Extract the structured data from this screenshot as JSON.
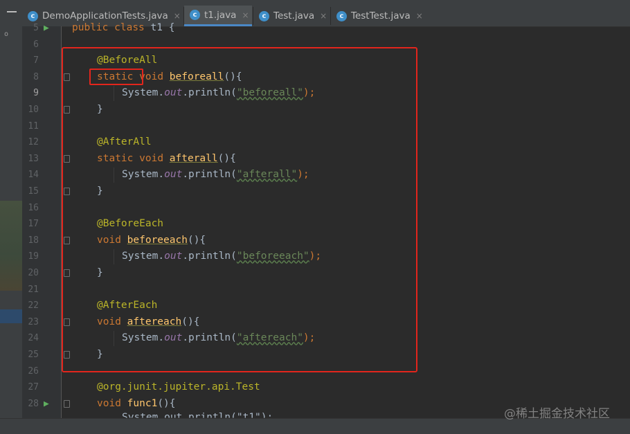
{
  "tabs": [
    {
      "label": "DemoApplicationTests.java",
      "icon": "c",
      "active": false
    },
    {
      "label": "t1.java",
      "icon": "c",
      "active": true
    },
    {
      "label": "Test.java",
      "icon": "c",
      "active": false
    },
    {
      "label": "TestTest.java",
      "icon": "c",
      "active": false
    }
  ],
  "close_glyph": "×",
  "line_numbers": [
    "5",
    "6",
    "7",
    "8",
    "9",
    "10",
    "11",
    "12",
    "13",
    "14",
    "15",
    "16",
    "17",
    "18",
    "19",
    "20",
    "21",
    "22",
    "23",
    "24",
    "25",
    "26",
    "27",
    "28"
  ],
  "current_line": "9",
  "code": {
    "l5": {
      "kw1": "public",
      "kw2": "class",
      "name": "t1",
      "brace": "{"
    },
    "l7": {
      "ann": "@BeforeAll"
    },
    "l8": {
      "kw1": "static",
      "kw2": "void",
      "fn": "beforeall",
      "rest": "(){"
    },
    "l9": {
      "obj": "System.",
      "field": "out",
      "call": ".println(",
      "str": "\"beforeall\"",
      "end": ");"
    },
    "l10": {
      "brace": "}"
    },
    "l12": {
      "ann": "@AfterAll"
    },
    "l13": {
      "kw1": "static",
      "kw2": "void",
      "fn": "afterall",
      "rest": "(){"
    },
    "l14": {
      "obj": "System.",
      "field": "out",
      "call": ".println(",
      "str": "\"afterall\"",
      "end": ");"
    },
    "l15": {
      "brace": "}"
    },
    "l17": {
      "ann": "@BeforeEach"
    },
    "l18": {
      "kw2": "void",
      "fn": "beforeeach",
      "rest": "(){"
    },
    "l19": {
      "obj": "System.",
      "field": "out",
      "call": ".println(",
      "str": "\"beforeeach\"",
      "end": ");"
    },
    "l20": {
      "brace": "}"
    },
    "l22": {
      "ann": "@AfterEach"
    },
    "l23": {
      "kw2": "void",
      "fn": "aftereach",
      "rest": "(){"
    },
    "l24": {
      "obj": "System.",
      "field": "out",
      "call": ".println(",
      "str": "\"aftereach\"",
      "end": ");"
    },
    "l25": {
      "brace": "}"
    },
    "l27": {
      "ann": "@org.junit.jupiter.api.Test"
    },
    "l28": {
      "kw2": "void",
      "fn": "func1",
      "rest": "(){"
    },
    "l29": {
      "partial": "System.out.println(\"t1\");"
    }
  },
  "watermark": "@稀土掘金技术社区",
  "colors": {
    "editor_bg": "#2b2b2b",
    "keyword": "#cc7832",
    "annotation": "#bbb529",
    "method": "#ffc66d",
    "string": "#6a8759",
    "highlight_box": "#e3251c",
    "tab_accent": "#4a88c7"
  },
  "icons": {
    "tab_file": "java-class-icon",
    "run_gutter": "run-icon",
    "fold": "fold-marker-icon"
  }
}
